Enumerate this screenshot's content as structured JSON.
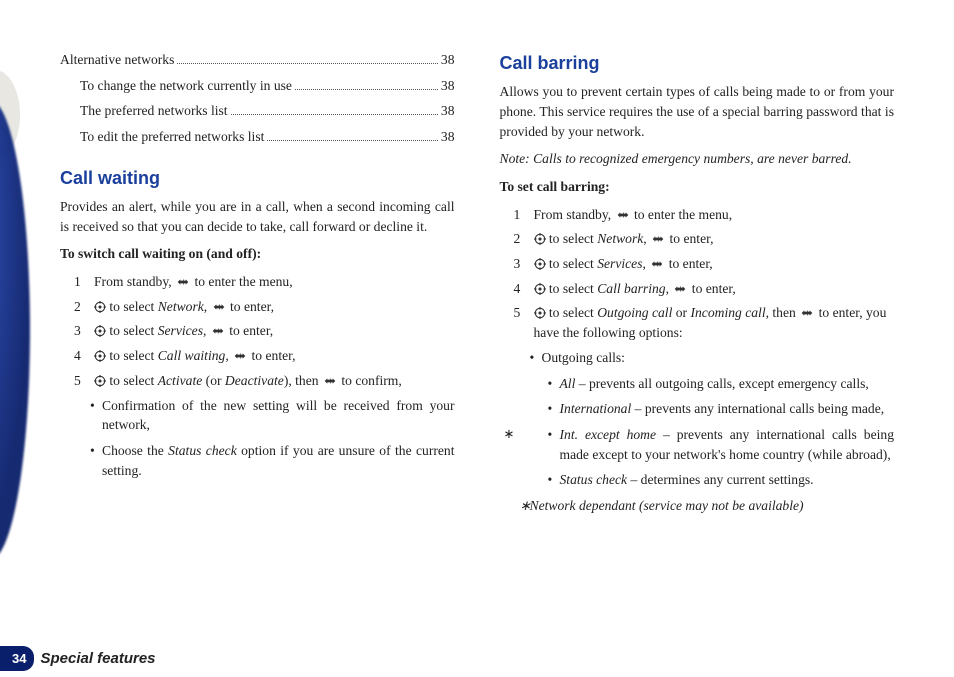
{
  "toc": [
    {
      "label": "Alternative networks",
      "page": "38",
      "indent": 0
    },
    {
      "label": "To change the network currently in use",
      "page": "38",
      "indent": 1
    },
    {
      "label": "The preferred networks list",
      "page": "38",
      "indent": 1
    },
    {
      "label": "To edit the preferred networks list",
      "page": "38",
      "indent": 1
    }
  ],
  "left": {
    "heading": "Call waiting",
    "intro": "Provides an alert, while you are in a call, when a second incoming call is received so that you can decide to take, call forward or decline it.",
    "sub": "To switch call waiting on (and off):",
    "steps": [
      {
        "a": "From standby, ",
        "b": " to enter the menu,",
        "icon": "nav"
      },
      {
        "a": "",
        "t1": " to select ",
        "i1": "Network",
        "t2": ", ",
        "t3": " to enter,",
        "icon1": "target",
        "icon2": "nav"
      },
      {
        "a": "",
        "t1": " to select ",
        "i1": "Services",
        "t2": ", ",
        "t3": " to enter,",
        "icon1": "target",
        "icon2": "nav"
      },
      {
        "a": "",
        "t1": " to select ",
        "i1": "Call waiting",
        "t2": ", ",
        "t3": " to enter,",
        "icon1": "target",
        "icon2": "nav"
      },
      {
        "a": "",
        "t1": " to select ",
        "i1": "Activate",
        "mid": " (or ",
        "i2": "Deactivate",
        "t2": "), then ",
        "t3": " to confirm,",
        "icon1": "target",
        "icon2": "nav"
      }
    ],
    "bullets": [
      "Confirmation of the new setting will be received from your network,",
      {
        "a": "Choose the ",
        "i": "Status check",
        "b": " option if you are unsure of the current setting."
      }
    ]
  },
  "right": {
    "heading": "Call barring",
    "intro": "Allows you to prevent certain types of calls being made to or from your phone. This service requires the use of a special barring password that is provided by your network.",
    "note": "Note: Calls to recognized emergency numbers, are never barred.",
    "sub": "To set call barring:",
    "steps": [
      {
        "a": "From standby, ",
        "b": " to enter the menu,",
        "icon": "nav"
      },
      {
        "t1": " to select ",
        "i1": "Network",
        "t2": ", ",
        "t3": " to enter,",
        "icon1": "target",
        "icon2": "nav"
      },
      {
        "t1": " to select ",
        "i1": "Services",
        "t2": ", ",
        "t3": " to enter,",
        "icon1": "target",
        "icon2": "nav"
      },
      {
        "t1": " to select ",
        "i1": "Call barring",
        "t2": ", ",
        "t3": " to enter,",
        "icon1": "target",
        "icon2": "nav"
      },
      {
        "t1": " to select ",
        "i1": "Outgoing call",
        "mid": " or ",
        "i2": "Incoming call",
        "t2": ", then ",
        "t3": " to enter, you have the following options:",
        "icon1": "target",
        "icon2": "nav"
      }
    ],
    "l1": [
      "Outgoing calls:"
    ],
    "l2": [
      {
        "i": "All",
        "t": " – prevents all outgoing calls, except emergency calls,",
        "star": false
      },
      {
        "i": "International",
        "t": " – prevents any international calls being made,",
        "star": false
      },
      {
        "i": "Int. except home",
        "t": " – prevents any international calls being made except to your network's home country (while abroad),",
        "star": true
      },
      {
        "i": "Status check",
        "t": " – determines any current settings.",
        "star": false
      }
    ],
    "footnote": "Network dependant (service may not be available)"
  },
  "footer": {
    "page": "34",
    "title": "Special features"
  }
}
